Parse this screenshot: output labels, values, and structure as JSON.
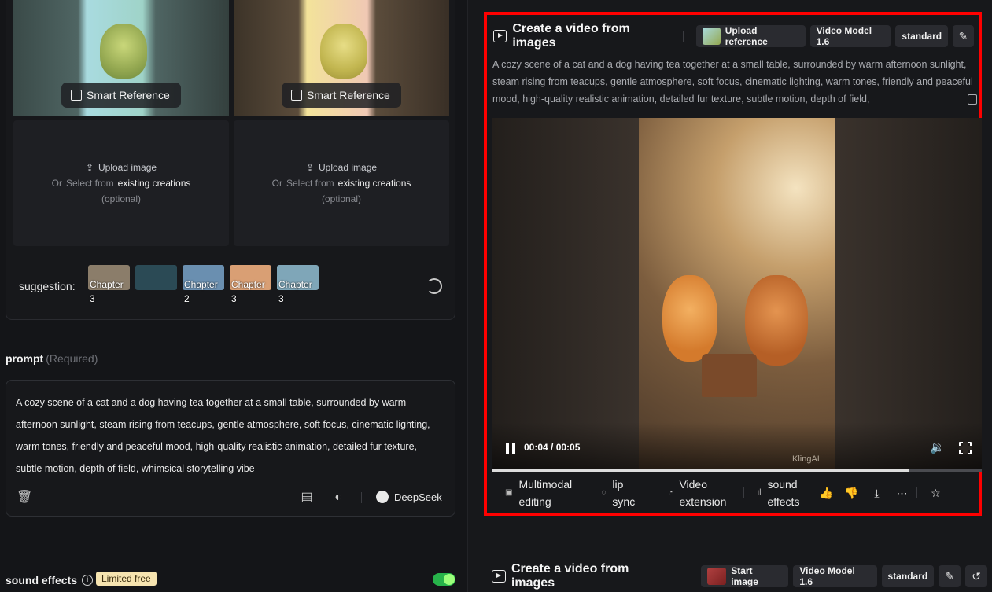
{
  "left": {
    "reference_cards": [
      {
        "smart_reference_label": "Smart Reference"
      },
      {
        "smart_reference_label": "Smart Reference"
      }
    ],
    "upload_slots": [
      {
        "upload_label": "Upload image",
        "or_label": "Or",
        "select_label": "Select from",
        "existing_label": "existing creations",
        "optional_label": "(optional)"
      },
      {
        "upload_label": "Upload image",
        "or_label": "Or",
        "select_label": "Select from",
        "existing_label": "existing creations",
        "optional_label": "(optional)"
      }
    ],
    "suggestion": {
      "label": "suggestion:",
      "items": [
        {
          "caption": "Chapter 3",
          "color": "#8b7d6a"
        },
        {
          "caption": "",
          "color": "#2b4a55"
        },
        {
          "caption": "Chapter 2",
          "color": "#6a8fb0"
        },
        {
          "caption": "Chapter 3",
          "color": "#d99f74"
        },
        {
          "caption": "Chapter 3",
          "color": "#7fa6b8"
        }
      ]
    },
    "prompt": {
      "title": "prompt",
      "required": "(Required)",
      "text": "A cozy scene of a cat and a dog having tea together at a small table, surrounded by warm afternoon sunlight, steam rising from teacups, gentle atmosphere, soft focus, cinematic lighting, warm tones, friendly and peaceful mood, high-quality realistic animation, detailed fur texture, subtle motion, depth of field, whimsical storytelling vibe",
      "deepseek_label": "DeepSeek"
    },
    "sound_effects": {
      "label": "sound effects",
      "badge": "Limited free",
      "enabled": true
    }
  },
  "right": {
    "card": {
      "title": "Create a video from images",
      "chips": [
        "Upload reference",
        "Video Model 1.6",
        "standard"
      ],
      "description": "A cozy scene of a cat and a dog having tea together at a small table, surrounded by warm afternoon sunlight, steam rising from teacups, gentle atmosphere, soft focus, cinematic lighting, warm tones, friendly and peaceful mood, high-quality realistic animation, detailed fur texture, subtle motion, depth of field,",
      "video": {
        "time": "00:04 / 00:05",
        "watermark": "KlingAI",
        "progress": 0.85
      },
      "actions": [
        {
          "label": "Multimodal editing",
          "icon": "edit-multimodal-icon"
        },
        {
          "label": "lip sync",
          "icon": "lip-icon"
        },
        {
          "label": "Video extension",
          "icon": "extend-icon"
        },
        {
          "label": "sound effects",
          "icon": "waveform-icon"
        }
      ]
    },
    "card2": {
      "title": "Create a video from images",
      "chips": [
        "Start image",
        "Video Model 1.6",
        "standard"
      ]
    }
  }
}
